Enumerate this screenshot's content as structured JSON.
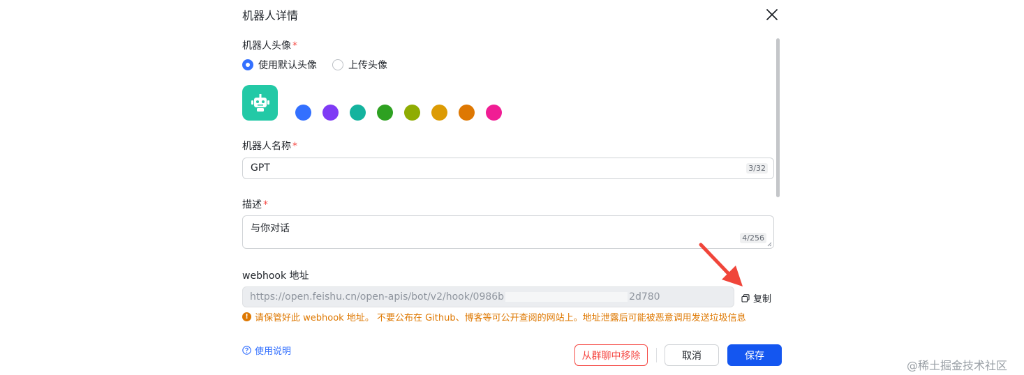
{
  "dialog": {
    "title": "机器人详情",
    "close_icon": "close-icon"
  },
  "avatar_section": {
    "label": "机器人头像",
    "required_mark": "*",
    "options": [
      {
        "label": "使用默认头像",
        "checked": true
      },
      {
        "label": "上传头像",
        "checked": false
      }
    ],
    "avatar_icon": "robot-icon",
    "avatar_color": "#23c9a6",
    "swatches": [
      "#3370ff",
      "#7f3bf5",
      "#14b39e",
      "#2ea121",
      "#8fac02",
      "#dc9b04",
      "#de7802",
      "#f01d94"
    ]
  },
  "name_section": {
    "label": "机器人名称",
    "required_mark": "*",
    "value": "GPT",
    "counter": "3/32"
  },
  "desc_section": {
    "label": "描述",
    "required_mark": "*",
    "value": "与你对话",
    "counter": "4/256"
  },
  "webhook_section": {
    "label": "webhook 地址",
    "url_prefix": "https://open.feishu.cn/open-apis/bot/v2/hook/0986b",
    "url_suffix": "2d780",
    "copy_label": "复制",
    "warning": "请保管好此 webhook 地址。 不要公布在 Github、博客等可公开查阅的网站上。地址泄露后可能被恶意调用发送垃圾信息"
  },
  "footer": {
    "help_label": "使用说明",
    "remove_label": "从群聊中移除",
    "cancel_label": "取消",
    "save_label": "保存"
  },
  "watermark": "@稀土掘金技术社区",
  "colors": {
    "primary": "#1456f0",
    "danger": "#f54a45",
    "warning": "#de7802",
    "annotation_arrow": "#f0453a"
  }
}
